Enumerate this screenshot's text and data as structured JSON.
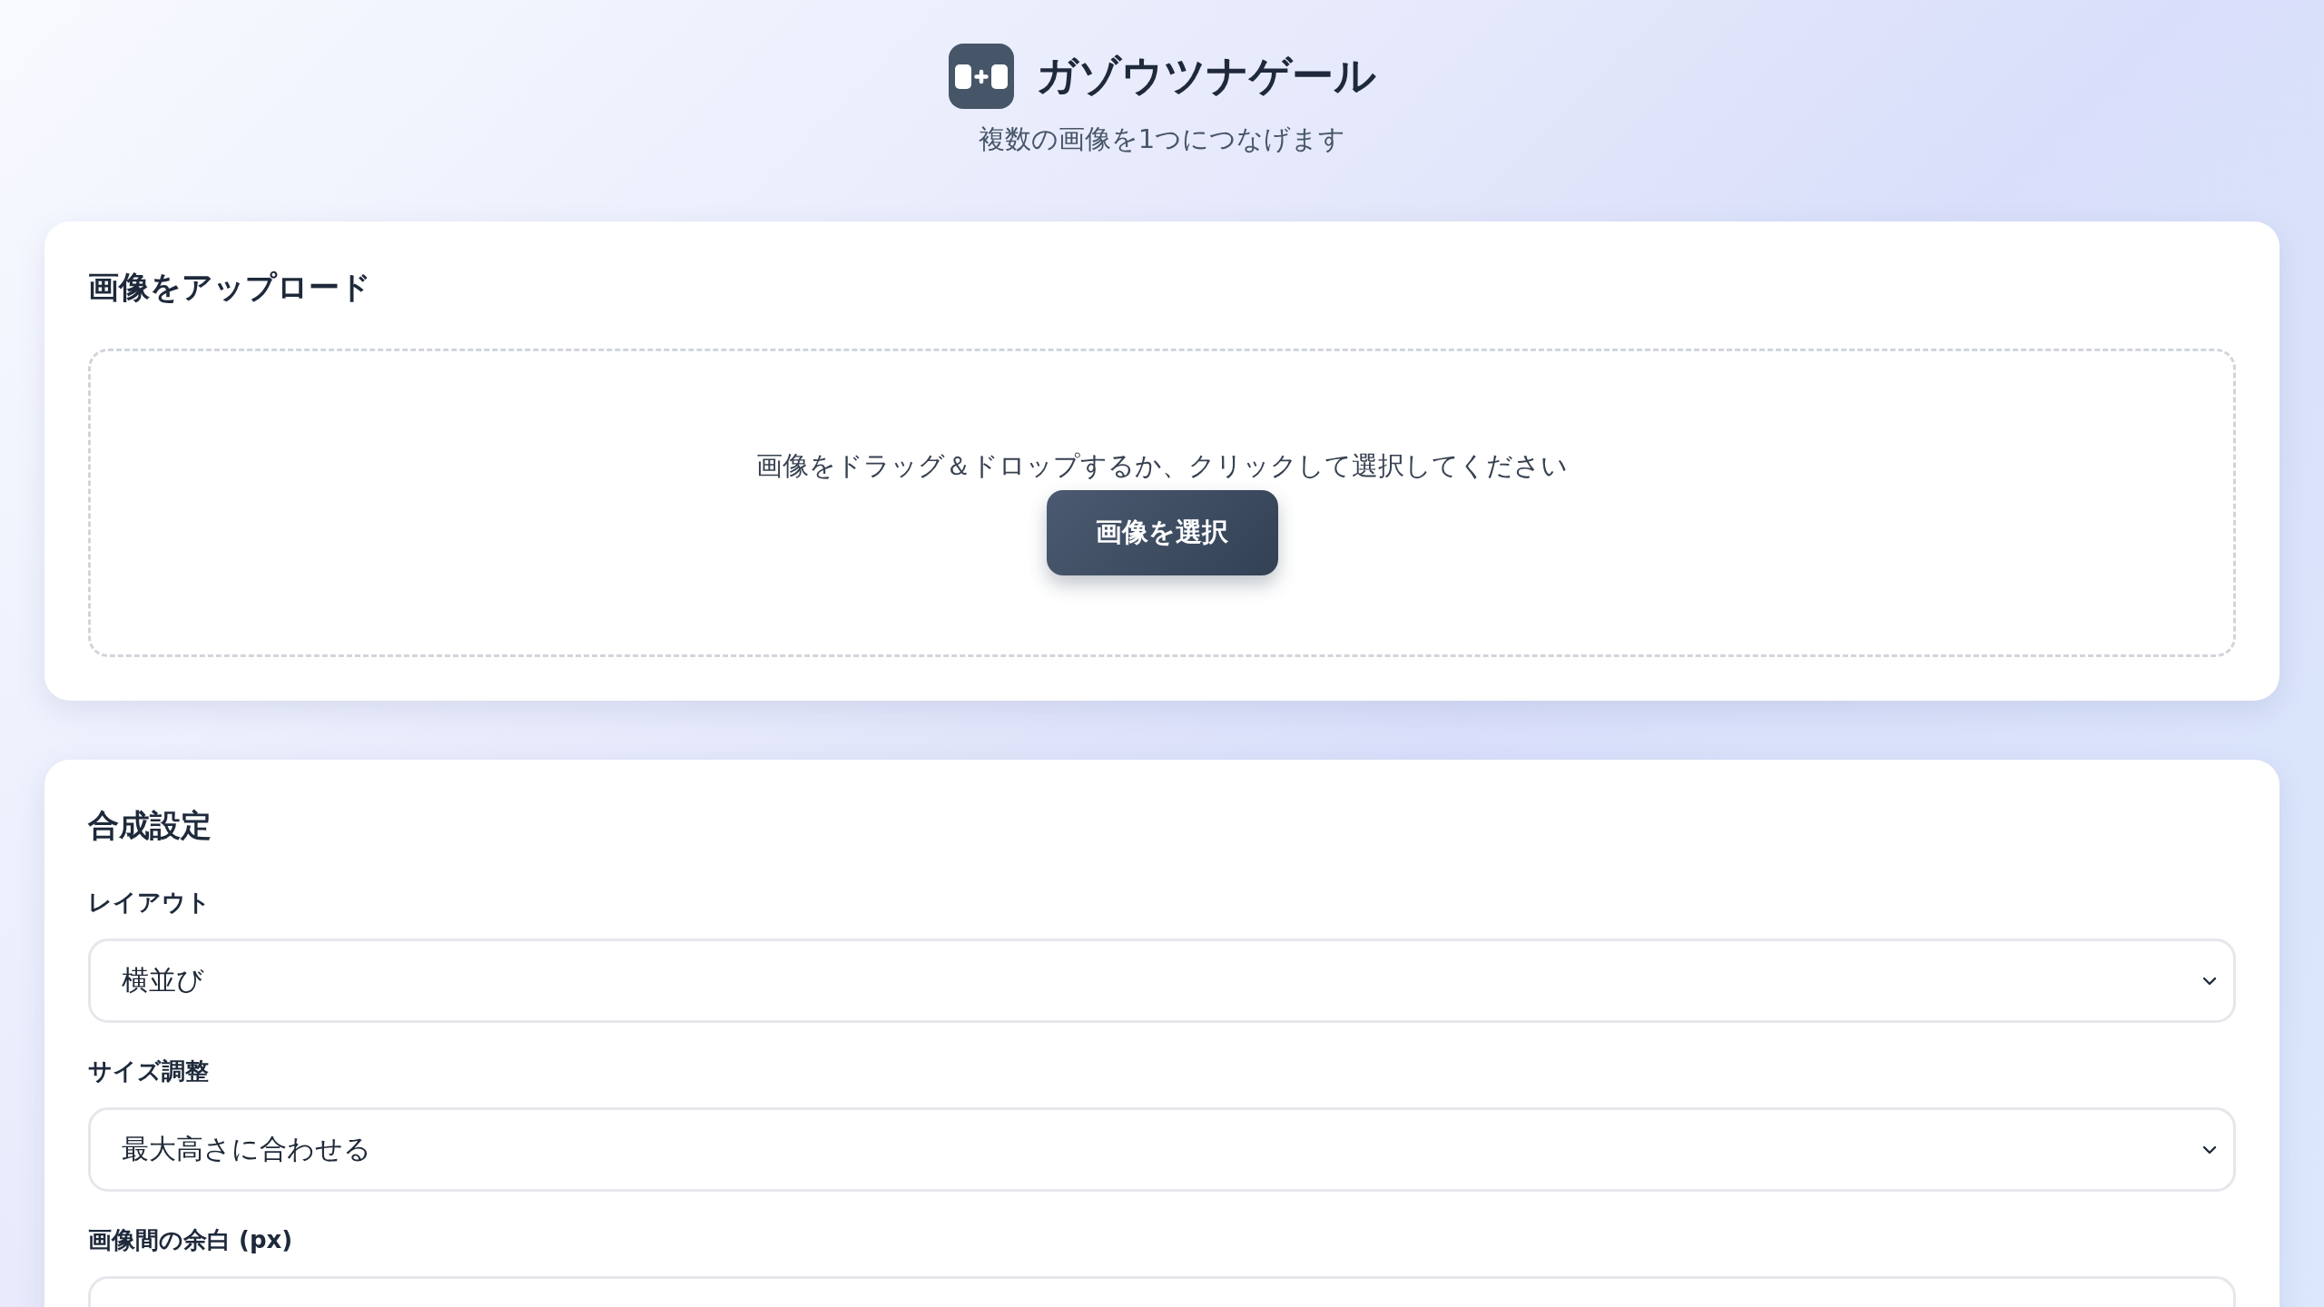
{
  "header": {
    "title": "ガゾウツナゲール",
    "subtitle": "複数の画像を1つにつなげます"
  },
  "upload": {
    "heading": "画像をアップロード",
    "instruction": "画像をドラッグ＆ドロップするか、クリックして選択してください",
    "button": "画像を選択"
  },
  "settings": {
    "heading": "合成設定",
    "fields": [
      {
        "kind": "select",
        "label": "レイアウト",
        "value": "横並び"
      },
      {
        "kind": "select",
        "label": "サイズ調整",
        "value": "最大高さに合わせる"
      },
      {
        "kind": "number",
        "label": "画像間の余白 (px)"
      }
    ]
  }
}
